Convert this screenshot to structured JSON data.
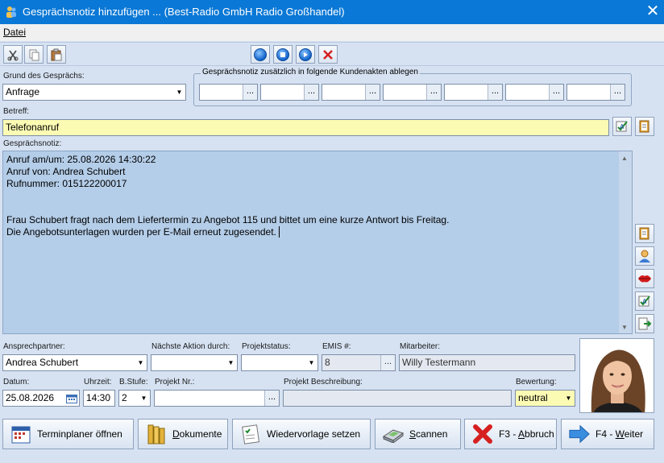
{
  "window": {
    "title": "Gesprächsnotiz hinzufügen ...  (Best-Radio GmbH Radio Großhandel)",
    "close_glyph": "✕"
  },
  "menu": {
    "items": [
      "Datei"
    ]
  },
  "toolbar": {
    "left_icons": [
      "scissors-icon",
      "copy-icon",
      "paste-icon"
    ],
    "media_icons": [
      "record-icon",
      "stop-icon",
      "play-icon",
      "delete-x-icon"
    ]
  },
  "form": {
    "grund_label": "Grund des Gesprächs:",
    "grund_value": "Anfrage",
    "kundenakten_title": "Gesprächsnotiz zusätzlich in folgende Kundenakten ablegen",
    "kundenakten_dots": "...",
    "betreff_label": "Betreff:",
    "betreff_value": "Telefonanruf",
    "notiz_label": "Gesprächsnotiz:",
    "notiz_lines": [
      "Anruf am/um: 25.08.2026 14:30:22",
      "Anruf von: Andrea Schubert",
      "Rufnummer: 015122200017",
      "",
      "Frau Schubert fragt nach dem Liefertermin zu Angebot 115 und bittet um eine kurze Antwort bis Freitag.",
      "Die Angebotsunterlagen wurden per E-Mail erneut zugesendet."
    ],
    "ansprechpartner_label": "Ansprechpartner:",
    "ansprechpartner_value": "Andrea Schubert",
    "naechste_aktion_label": "Nächste Aktion durch:",
    "naechste_aktion_value": "",
    "projektstatus_label": "Projektstatus:",
    "projektstatus_value": "",
    "emis_label": "EMIS #:",
    "emis_value": "8",
    "mitarbeiter_label": "Mitarbeiter:",
    "mitarbeiter_value": "Willy Testermann",
    "datum_label": "Datum:",
    "datum_value": "25.08.2026",
    "uhrzeit_label": "Uhrzeit:",
    "uhrzeit_value": "14:30",
    "bstufe_label": "B.Stufe:",
    "bstufe_value": "2",
    "projekt_nr_label": "Projekt Nr.:",
    "projekt_nr_value": "",
    "projekt_beschreibung_label": "Projekt Beschreibung:",
    "projekt_beschreibung_value": "",
    "bewertung_label": "Bewertung:",
    "bewertung_value": "neutral"
  },
  "buttons": {
    "terminplaner": "Terminplaner öffnen",
    "dokumente": "Dokumente",
    "wiedervorlage": "Wiedervorlage setzen",
    "scannen": "Scannen",
    "abbruch": "F3 - Abbruch",
    "weiter_prefix": "F4 - ",
    "weiter_u": "W",
    "weiter_rest": "eiter",
    "dok_u": "D",
    "dok_rest": "okumente",
    "scan_u": "S",
    "scan_rest": "cannen",
    "abbruch_prefix": "F3 - ",
    "abbruch_u": "A",
    "abbruch_rest": "bbruch"
  },
  "colors": {
    "titlebar": "#0a78d6",
    "notes_bg": "#b4cde8",
    "betreff_bg": "#fbfbb4"
  }
}
